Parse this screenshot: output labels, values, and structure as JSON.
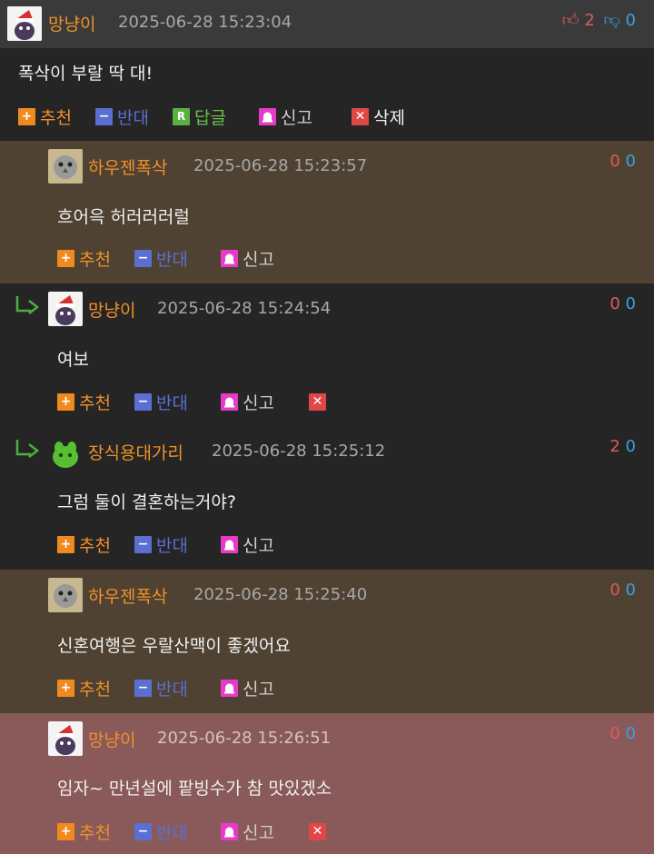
{
  "comments": [
    {
      "nick": "망냥이",
      "time": "2025-06-28 15:23:04",
      "up": "2",
      "down": "0",
      "text": "폭삭이 부랄 딱 대!",
      "actions": {
        "recommend": "추천",
        "oppose": "반대",
        "reply": "답글",
        "reply_icon": "R",
        "report": "신고",
        "delete": "삭제"
      }
    },
    {
      "nick": "하우젠폭삭",
      "time": "2025-06-28 15:23:57",
      "up": "0",
      "down": "0",
      "text": "흐어윽 허러러러럴",
      "actions": {
        "recommend": "추천",
        "oppose": "반대",
        "report": "신고"
      }
    },
    {
      "nick": "망냥이",
      "time": "2025-06-28 15:24:54",
      "up": "0",
      "down": "0",
      "text": "여보",
      "actions": {
        "recommend": "추천",
        "oppose": "반대",
        "report": "신고"
      }
    },
    {
      "nick": "장식용대가리",
      "time": "2025-06-28 15:25:12",
      "up": "2",
      "down": "0",
      "text": "그럼 둘이 결혼하는거야?",
      "actions": {
        "recommend": "추천",
        "oppose": "반대",
        "report": "신고"
      }
    },
    {
      "nick": "하우젠폭삭",
      "time": "2025-06-28 15:25:40",
      "up": "0",
      "down": "0",
      "text": "신혼여행은 우랄산맥이 좋겠어요",
      "actions": {
        "recommend": "추천",
        "oppose": "반대",
        "report": "신고"
      }
    },
    {
      "nick": "망냥이",
      "time": "2025-06-28 15:26:51",
      "up": "0",
      "down": "0",
      "text": "임자~ 만년설에 팥빙수가 참 맛있겠소",
      "actions": {
        "recommend": "추천",
        "oppose": "반대",
        "report": "신고"
      }
    }
  ],
  "colors": {
    "bg_dark": "#252525",
    "bg_header_dark": "#3a3a3a",
    "bg_brown": "#4f4232",
    "bg_highlight": "#8a5a5a",
    "nick": "#f0902a",
    "up": "#e05a5a",
    "down": "#3aa0e0"
  }
}
